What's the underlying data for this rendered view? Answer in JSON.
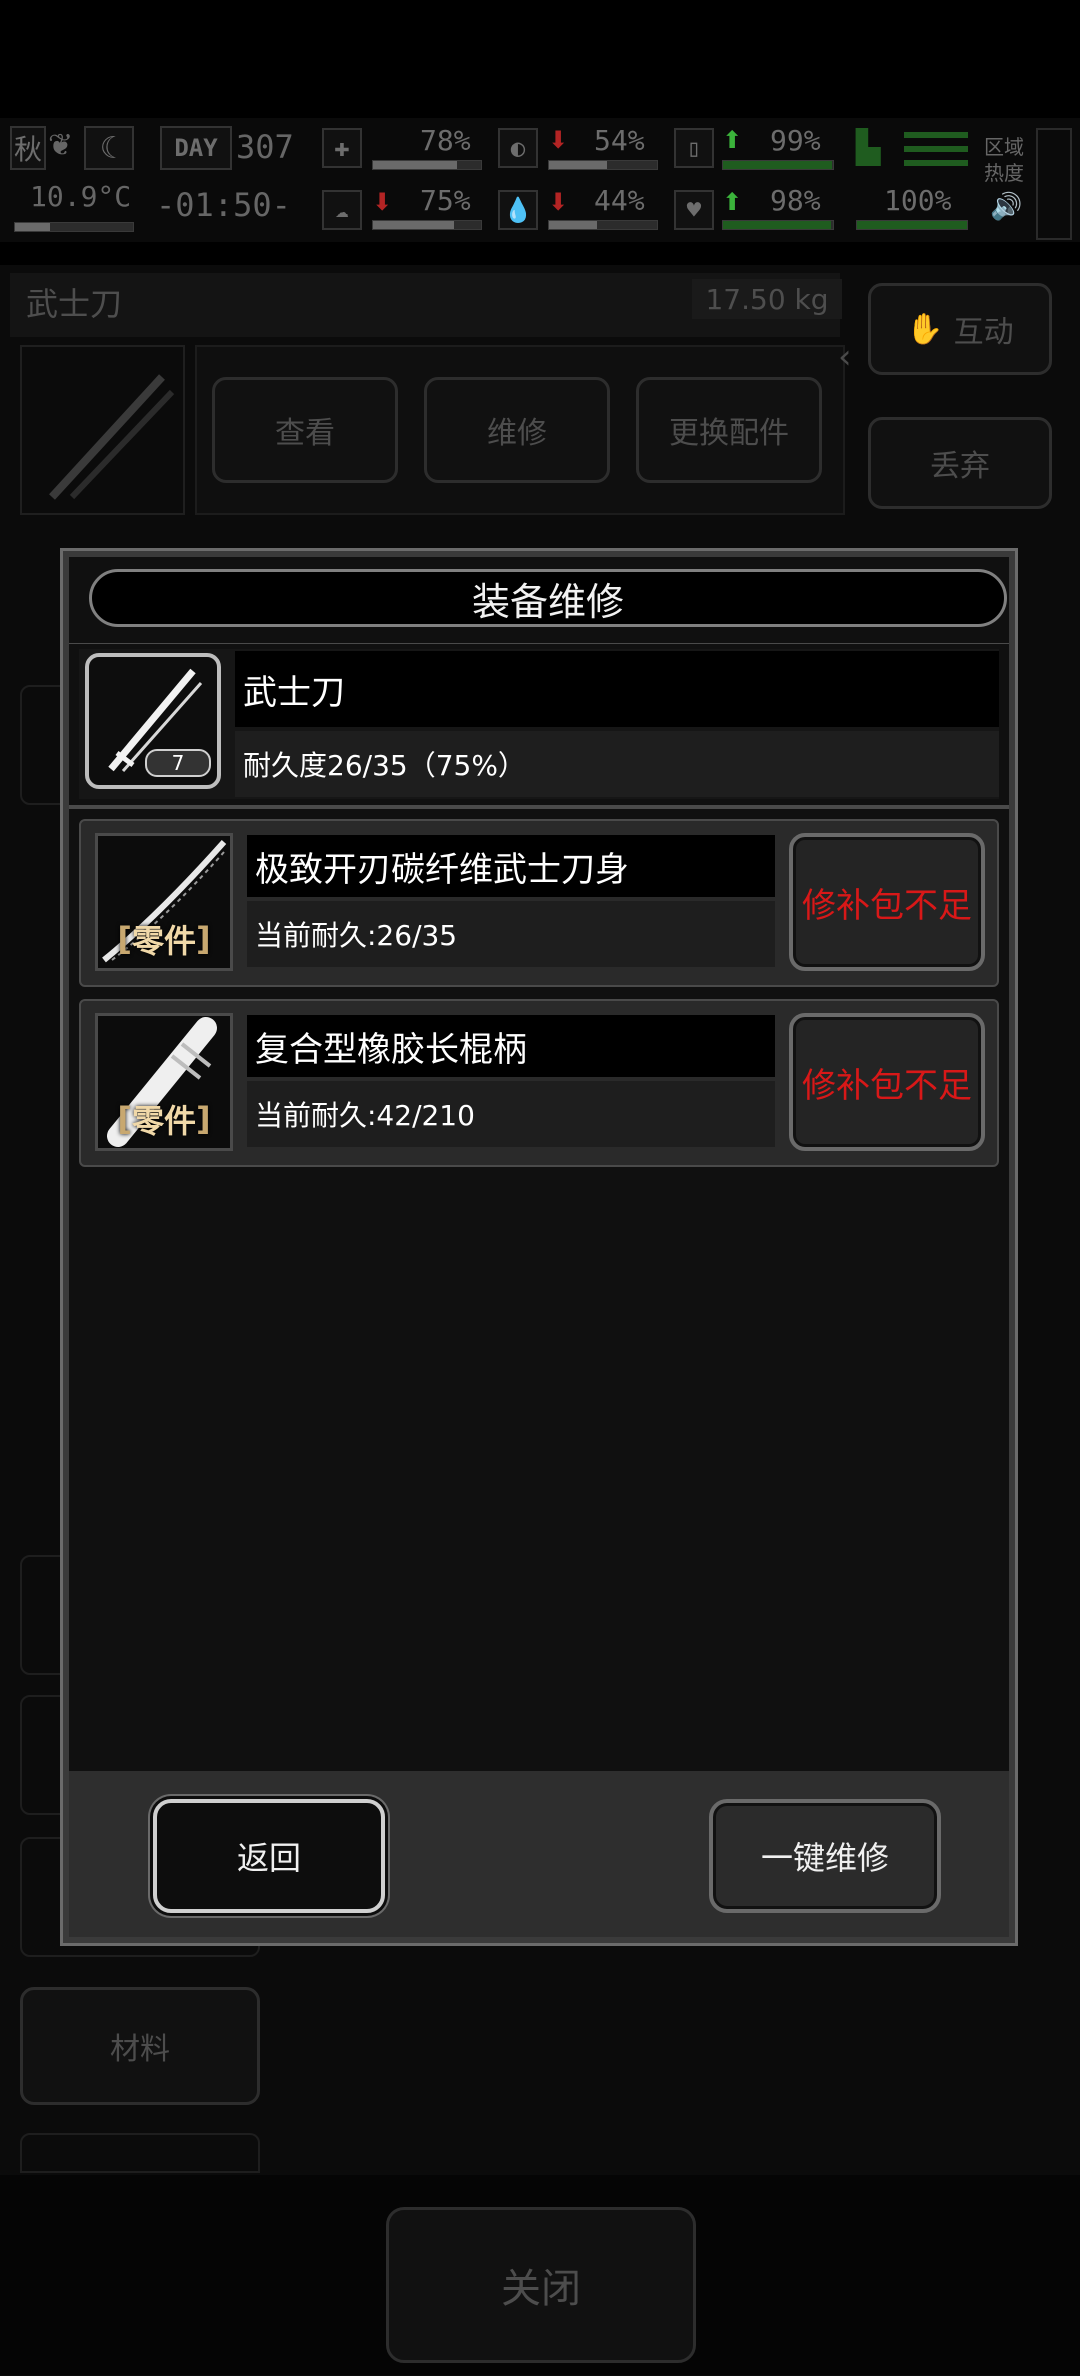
{
  "status": {
    "season": "秋",
    "day_label": "DAY",
    "day": "307",
    "temperature": "10.9°C",
    "time": "-01:50-",
    "stats": [
      {
        "icon": "medkit-icon",
        "value": "78%",
        "level": 0.78
      },
      {
        "icon": "stomach-icon",
        "value": "54%",
        "level": 0.54
      },
      {
        "icon": "battery-icon",
        "value": "99%",
        "level": 0.99
      },
      {
        "icon": "brain-icon",
        "value": "75%",
        "level": 0.75
      },
      {
        "icon": "water-drop-icon",
        "value": "44%",
        "level": 0.44
      },
      {
        "icon": "heart-icon",
        "value": "98%",
        "level": 0.98
      },
      {
        "icon": "boot-icon",
        "value": "100%",
        "level": 1.0
      }
    ],
    "region_heat": "区域\n热度"
  },
  "background": {
    "item_title": "武士刀",
    "item_weight": "17.50 kg",
    "buttons": {
      "view": "查看",
      "repair": "维修",
      "replace_parts": "更换配件"
    },
    "interact": "互动",
    "discard": "丢弃",
    "materials": "材料",
    "close": "关闭"
  },
  "modal": {
    "title": "装备维修",
    "equipment": {
      "name": "武士刀",
      "durability": "耐久度26/35（75%）",
      "badge": "7"
    },
    "parts": [
      {
        "tag": "零件",
        "name": "极致开刃碳纤维武士刀身",
        "current": "当前耐久:26/35",
        "action": "修补包不足"
      },
      {
        "tag": "零件",
        "name": "复合型橡胶长棍柄",
        "current": "当前耐久:42/210",
        "action": "修补包不足"
      }
    ],
    "back": "返回",
    "repair_all": "一键维修"
  },
  "colors": {
    "warning": "#d81818",
    "accent_green": "#3bb33b",
    "accent_red": "#b32424"
  }
}
